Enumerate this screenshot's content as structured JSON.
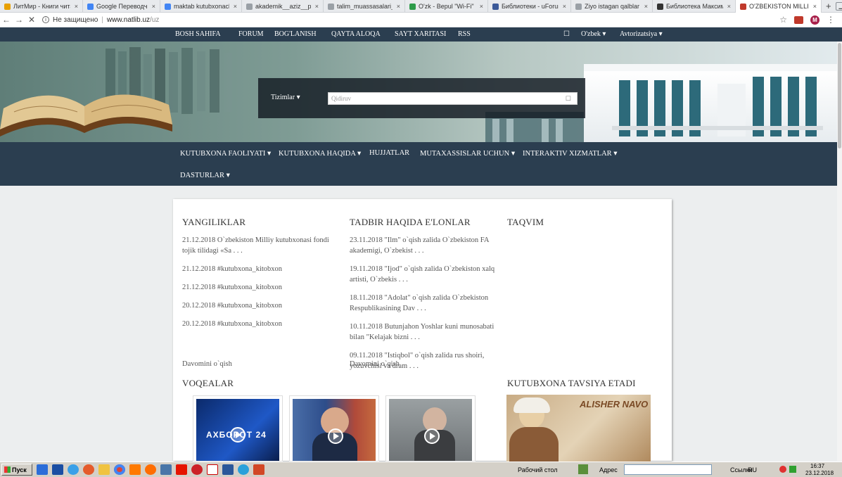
{
  "browser": {
    "tabs": [
      {
        "title": "ЛитМир - Книги читат",
        "color": "#e8a000"
      },
      {
        "title": "Google Переводчик",
        "color": "#4285f4"
      },
      {
        "title": "maktab kutubxonachi",
        "color": "#4285f4"
      },
      {
        "title": "akademik__aziz__poli",
        "color": "#9aa0a6"
      },
      {
        "title": "talim_muassasalari_uc",
        "color": "#9aa0a6"
      },
      {
        "title": "O'zk - Bepul \"Wi-Fi\" h",
        "color": "#2e9c4a"
      },
      {
        "title": "Библиотеки - uForum",
        "color": "#3b5998"
      },
      {
        "title": "Ziyo istagan qalblar uc",
        "color": "#9aa0a6"
      },
      {
        "title": "Библиотека Максима",
        "color": "#333333"
      },
      {
        "title": "O'ZBEKISTON MILLIY",
        "color": "#c0392b"
      }
    ],
    "new_tab": "+",
    "tab_close": "×",
    "nav": {
      "back": "←",
      "forward": "→",
      "stop": "✕"
    },
    "address": {
      "security": "Не защищено",
      "host": "www.natlib.uz",
      "path": "/uz"
    },
    "avatar": "M",
    "star": "☆",
    "menu": "⋮"
  },
  "site": {
    "topnav": [
      "BOSH SAHIFA",
      "FORUM",
      "BOG'LANISH",
      "QAYTA ALOQA",
      "SAYT XARITASI",
      "RSS"
    ],
    "lang_icon": "☐",
    "lang": "O'zbek ▾",
    "auth": "Avtorizatsiya ▾",
    "search": {
      "systems": "Tizimlar ▾",
      "placeholder": "Qidiruv",
      "cal": "☐"
    },
    "mainnav_row1": [
      "KUTUBXONA FAOLIYATI ▾",
      "KUTUBXONA HAQIDA ▾",
      "HUJJATLAR",
      "MUTAXASSISLAR UCHUN ▾",
      "INTERAKTIV XIZMATLAR ▾"
    ],
    "mainnav_row2": [
      "DASTURLAR ▾"
    ],
    "news": {
      "title": "YANGILIKLAR",
      "items": [
        "21.12.2018 O`zbekiston Milliy kutubxonasi fondi tojik tilidagi «Sa . . .",
        "21.12.2018 #kutubxona_kitobxon",
        "21.12.2018 #kutubxona_kitobxon",
        "20.12.2018 #kutubxona_kitobxon",
        "20.12.2018 #kutubxona_kitobxon"
      ],
      "more": "Davomini o`qish"
    },
    "events": {
      "title": "TADBIR HAQIDA E'LONLAR",
      "items": [
        "23.11.2018 \"Ilm\" o`qish zalida O`zbekiston FA akademigi, O`zbekist . . .",
        "19.11.2018 \"Ijod\" o`qish zalida O`zbekiston xalq artisti, O`zbekis . . .",
        "18.11.2018 \"Adolat\" o`qish zalida O`zbekiston Respublikasining Dav . . .",
        "10.11.2018 Butunjahon Yoshlar kuni munosabati bilan \"Kelajak bizni . . .",
        "09.11.2018 \"Istiqbol\" o`qish zalida rus shoiri, yozuvchisi va dram . . ."
      ],
      "more": "Davomini o`qish"
    },
    "calendar": {
      "title": "TAQVIM"
    },
    "voqealar": {
      "title": "VOQEALAR",
      "video1_text": "АХБОРОТ 24"
    },
    "recommend": {
      "title": "KUTUBXONA TAVSIYA ETADI",
      "caption": "ALISHER NAVO"
    }
  },
  "taskbar": {
    "start": "Пуск",
    "desktop": "Рабочий стол",
    "address_label": "Адрес",
    "links": "Ссылки",
    "lang": "RU",
    "time": "16:37",
    "date": "23.12.2018"
  },
  "colors": {
    "nav_bg": "#2b3e50",
    "page_bg": "#eceeef",
    "card_bg": "#ffffff"
  }
}
